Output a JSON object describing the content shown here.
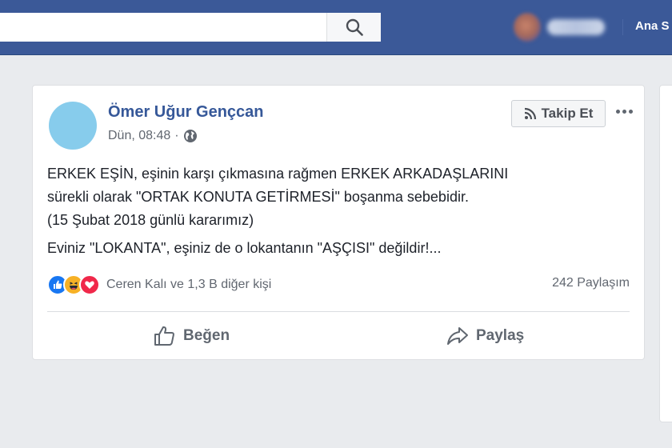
{
  "topbar": {
    "search_placeholder": "",
    "search_icon": "search-icon",
    "nav_home": "Ana S"
  },
  "post": {
    "author": "Ömer Uğur Gençcan",
    "time": "Dün, 08:48",
    "separator": "·",
    "privacy_icon": "globe-icon",
    "follow_label": "Takip Et",
    "follow_icon": "rss-icon",
    "text": {
      "line1": "ERKEK EŞİN, eşinin karşı çıkmasına rağmen ERKEK ARKADAŞLARINI",
      "line2": "sürekli olarak \"ORTAK KONUTA GETİRMESİ\" boşanma sebebidir.",
      "line3": "(15 Şubat 2018 günlü kararımız)",
      "line4": "Eviniz \"LOKANTA\", eşiniz de o lokantanın \"AŞÇISI\" değildir!..."
    },
    "reactions": {
      "icons": [
        "like-reaction-icon",
        "haha-reaction-icon",
        "love-reaction-icon"
      ],
      "summary": "Ceren Kalı ve 1,3 B diğer kişi"
    },
    "shares": "242 Paylaşım",
    "actions": {
      "like_label": "Beğen",
      "share_label": "Paylaş"
    }
  },
  "colors": {
    "topbar": "#3b5998",
    "link": "#365899",
    "background": "#e9ebee",
    "like_blue": "#1877f2",
    "love_red": "#f0284a",
    "haha_yellow": "#f7b125"
  }
}
